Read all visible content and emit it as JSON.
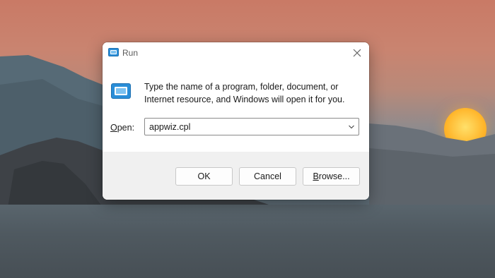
{
  "dialog": {
    "title": "Run",
    "icon": "run-icon",
    "description_line1": "Type the name of a program, folder, document, or",
    "description_line2": "Internet resource, and Windows will open it for you.",
    "open_label_accel": "O",
    "open_label_rest": "pen:",
    "open_value": "appwiz.cpl",
    "buttons": {
      "ok": "OK",
      "cancel": "Cancel",
      "browse_accel": "B",
      "browse_rest": "rowse..."
    }
  },
  "colors": {
    "dialog_bg": "#ffffff",
    "footer_bg": "#f0f0f0",
    "sky_top": "#c97a66",
    "sun": "#ffb52a"
  }
}
